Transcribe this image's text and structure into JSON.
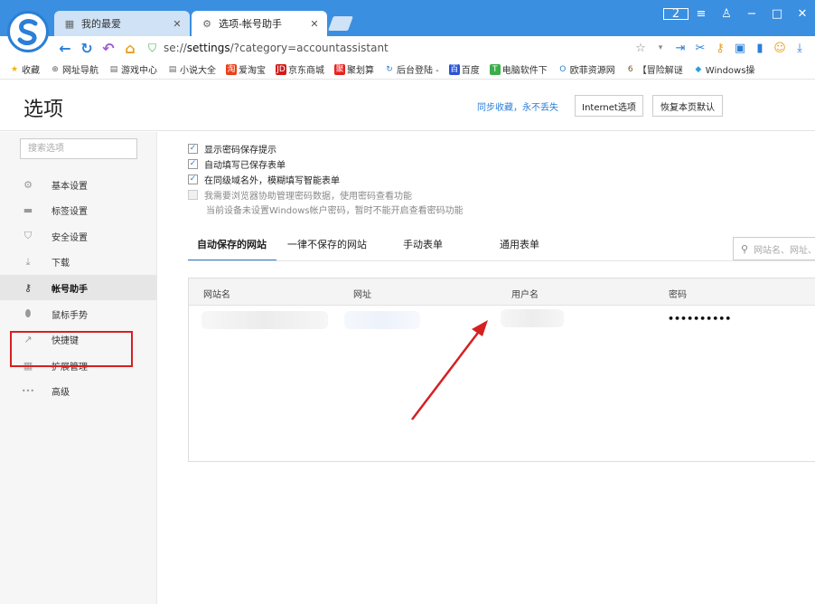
{
  "browser": {
    "tabs": [
      {
        "title": "我的最爱",
        "icon": "grid-icon"
      },
      {
        "title": "选项-帐号助手",
        "icon": "gear-icon"
      }
    ],
    "counter": "2",
    "url_prefix": "se://",
    "url_main": "settings",
    "url_rest": "/?category=accountassistant"
  },
  "bookmarks": [
    {
      "label": "收藏",
      "color": "#f0b400",
      "glyph": "★"
    },
    {
      "label": "网址导航",
      "color": "#666666",
      "glyph": "⊕"
    },
    {
      "label": "游戏中心",
      "color": "#666666",
      "glyph": "▤"
    },
    {
      "label": "小说大全",
      "color": "#666666",
      "glyph": "▤"
    },
    {
      "label": "爱淘宝",
      "color": "#e8401c",
      "glyph": "淘"
    },
    {
      "label": "京东商城",
      "color": "#d21a1a",
      "glyph": "JD"
    },
    {
      "label": "聚划算",
      "color": "#e8201c",
      "glyph": "聚"
    },
    {
      "label": "后台登陆 -",
      "color": "#2b7fd6",
      "glyph": "↻"
    },
    {
      "label": "百度",
      "color": "#2b55d6",
      "glyph": "百"
    },
    {
      "label": "电脑软件下",
      "color": "#3aae4a",
      "glyph": "T"
    },
    {
      "label": "欧菲资源网",
      "color": "#2b7fd6",
      "glyph": "O"
    },
    {
      "label": "【冒险解谜",
      "color": "#7a5a20",
      "glyph": "6"
    },
    {
      "label": "Windows操",
      "color": "#2b9fe0",
      "glyph": "◆"
    }
  ],
  "page": {
    "title": "选项",
    "sync_link": "同步收藏，永不丢失",
    "btn_ie": "Internet选项",
    "btn_reset": "恢复本页默认",
    "search_placeholder": "搜索选项"
  },
  "sidebar": {
    "items": [
      {
        "label": "基本设置",
        "icon": "gear-icon"
      },
      {
        "label": "标签设置",
        "icon": "tab-icon"
      },
      {
        "label": "安全设置",
        "icon": "shield-icon"
      },
      {
        "label": "下载",
        "icon": "download-icon"
      },
      {
        "label": "帐号助手",
        "icon": "key-icon",
        "active": true
      },
      {
        "label": "鼠标手势",
        "icon": "mouse-icon"
      },
      {
        "label": "快捷键",
        "icon": "shortcut-icon"
      },
      {
        "label": "扩展管理",
        "icon": "extensions-icon"
      },
      {
        "label": "高级",
        "icon": "more-icon"
      }
    ]
  },
  "options": [
    {
      "label": "显示密码保存提示",
      "checked": true
    },
    {
      "label": "自动填写已保存表单",
      "checked": true
    },
    {
      "label": "在同级域名外，模糊填写智能表单",
      "checked": true
    },
    {
      "label": "我需要浏览器协助管理密码数据，使用密码查看功能",
      "checked": false,
      "disabled": true
    }
  ],
  "option_note": "当前设备未设置Windows帐户密码，暂时不能开启查看密码功能",
  "subtabs": [
    "自动保存的网站",
    "一律不保存的网站",
    "手动表单",
    "通用表单"
  ],
  "table_search_placeholder": "网站名、网址、",
  "table": {
    "headers": [
      "网站名",
      "网址",
      "用户名",
      "密码"
    ],
    "password_mask": "••••••••••"
  },
  "colors": {
    "accent": "#2b7fd6",
    "titlebar": "#3b8fe0",
    "highlight": "#d62020"
  }
}
